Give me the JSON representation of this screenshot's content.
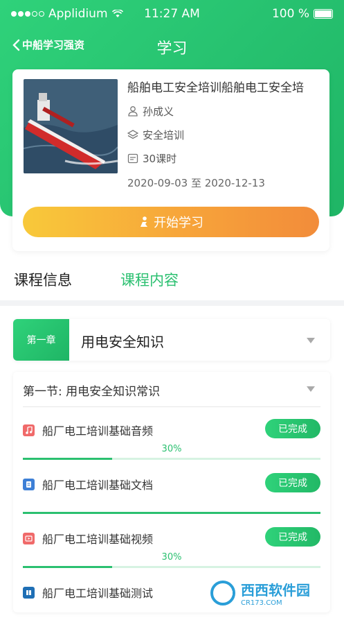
{
  "status_bar": {
    "carrier": "Applidium",
    "time": "11:27 AM",
    "battery": "100 %"
  },
  "nav": {
    "back_label": "中船学习强资",
    "title": "学习"
  },
  "course": {
    "title": "船舶电工安全培训船舶电工安全培",
    "teacher": "孙成义",
    "category": "安全培训",
    "hours": "30课时",
    "dates": "2020-09-03 至 2020-12-13",
    "start_label": "开始学习"
  },
  "tabs": [
    {
      "label": "课程信息"
    },
    {
      "label": "课程内容"
    }
  ],
  "chapter": {
    "badge": "第一章",
    "title": "用电安全知识"
  },
  "section": {
    "title": "第一节: 用电安全知识常识",
    "lessons": [
      {
        "icon": "audio-icon",
        "icon_color": "#f06a6a",
        "name": "船厂电工培训基础音频",
        "status": "已完成",
        "progress": 0.3,
        "progress_label": "30%"
      },
      {
        "icon": "document-icon",
        "icon_color": "#3d7fd6",
        "name": "船厂电工培训基础文档",
        "status": "已完成",
        "progress": 1.0,
        "progress_label": ""
      },
      {
        "icon": "video-icon",
        "icon_color": "#f06a6a",
        "name": "船厂电工培训基础视频",
        "status": "已完成",
        "progress": 0.3,
        "progress_label": "30%"
      },
      {
        "icon": "test-icon",
        "icon_color": "#1f6fb5",
        "name": "船厂电工培训基础测试",
        "status": "",
        "progress": 0,
        "progress_label": ""
      }
    ]
  },
  "watermark": {
    "text": "西西软件园",
    "site": "CR173.COM"
  },
  "colors": {
    "brand_green": "#2bc070",
    "start_button_from": "#f8c93a",
    "start_button_to": "#f28c3a"
  }
}
